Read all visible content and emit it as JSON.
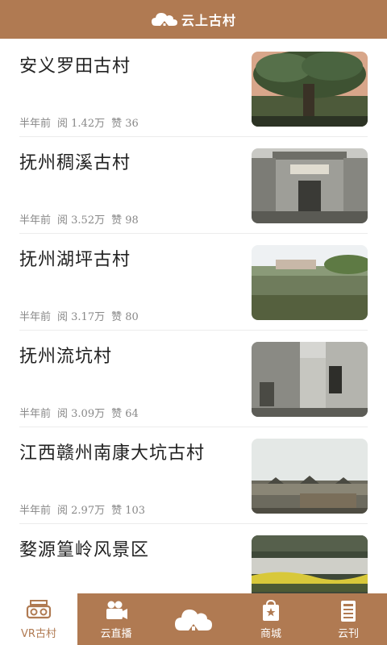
{
  "header": {
    "title": "云上古村",
    "logo_icon": "cloud-house-icon"
  },
  "articles": [
    {
      "title": "安义罗田古村",
      "time": "半年前",
      "views": "阅 1.42万",
      "likes": "赞 36"
    },
    {
      "title": "抚州稠溪古村",
      "time": "半年前",
      "views": "阅 3.52万",
      "likes": "赞 98"
    },
    {
      "title": "抚州湖坪古村",
      "time": "半年前",
      "views": "阅 3.17万",
      "likes": "赞 80"
    },
    {
      "title": "抚州流坑村",
      "time": "半年前",
      "views": "阅 3.09万",
      "likes": "赞 64"
    },
    {
      "title": "江西赣州南康大坑古村",
      "time": "半年前",
      "views": "阅 2.97万",
      "likes": "赞 103"
    },
    {
      "title": "婺源篁岭风景区",
      "time": "",
      "views": "",
      "likes": ""
    }
  ],
  "tabs": [
    {
      "label": "VR古村",
      "icon": "vr-glasses-icon",
      "active": true
    },
    {
      "label": "云直播",
      "icon": "video-camera-icon",
      "active": false
    },
    {
      "label": "",
      "icon": "cloud-house-icon",
      "active": false
    },
    {
      "label": "商城",
      "icon": "shopping-bag-icon",
      "active": false
    },
    {
      "label": "云刊",
      "icon": "magazine-icon",
      "active": false
    }
  ],
  "colors": {
    "brand": "#b07a52",
    "text": "#222222",
    "meta": "#888888"
  }
}
